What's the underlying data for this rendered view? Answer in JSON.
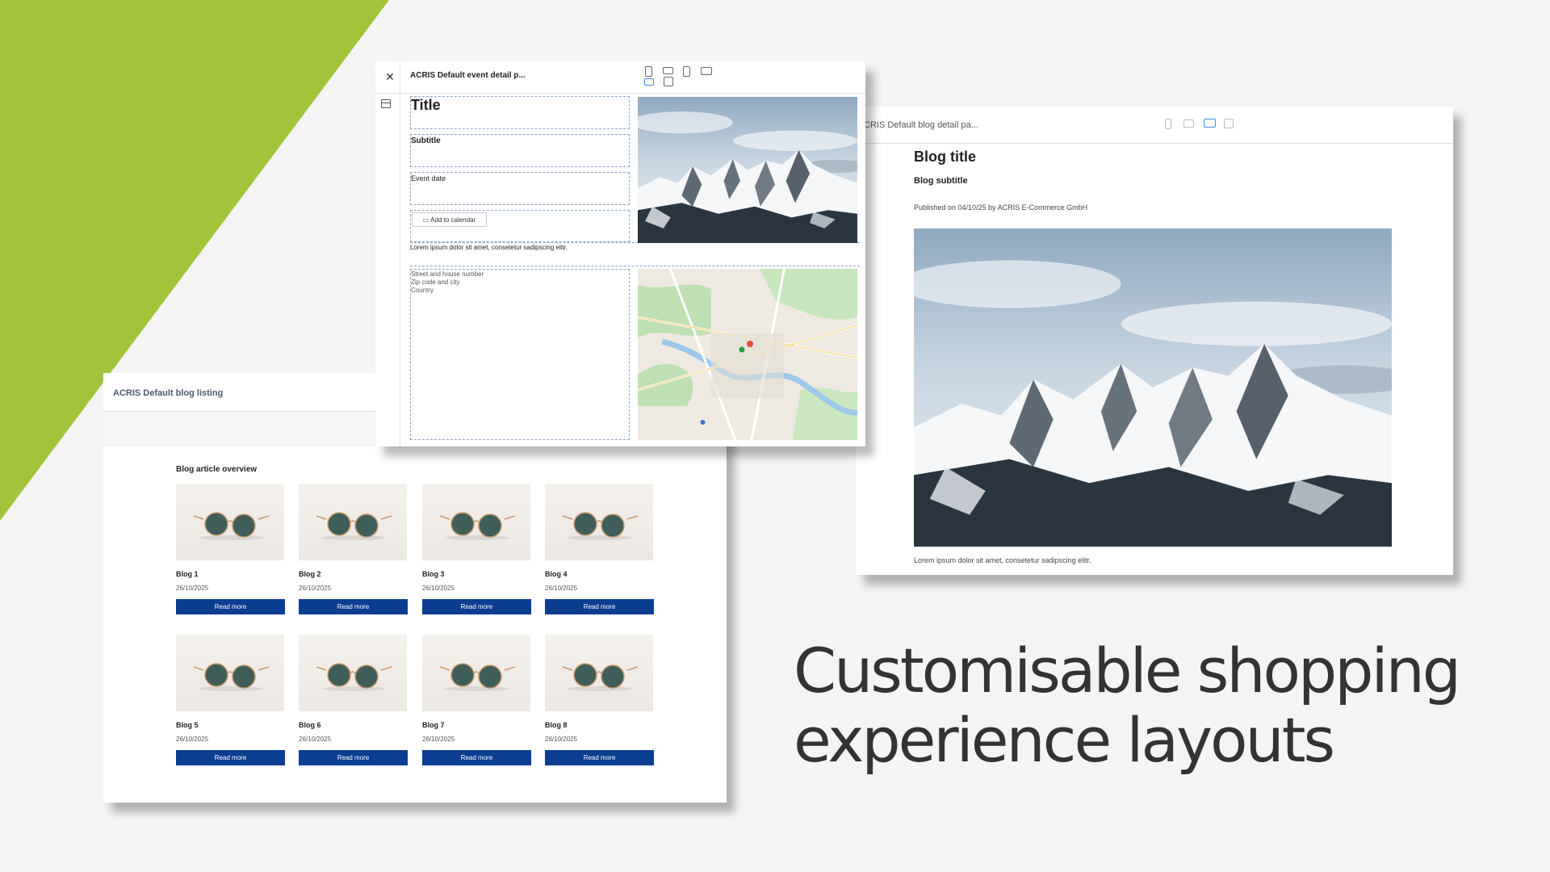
{
  "colors": {
    "accent_green": "#a3c43a",
    "button_blue": "#0b3d91",
    "selection_blue": "#3e8ee4"
  },
  "headline": {
    "line1": "Customisable shopping",
    "line2": "experience layouts"
  },
  "blog_listing": {
    "window_title": "ACRIS Default blog listing",
    "section_title": "Blog article overview",
    "cards": [
      {
        "title": "Blog 1",
        "date": "26/10/2025",
        "button": "Read more"
      },
      {
        "title": "Blog 2",
        "date": "26/10/2025",
        "button": "Read more"
      },
      {
        "title": "Blog 3",
        "date": "26/10/2025",
        "button": "Read more"
      },
      {
        "title": "Blog 4",
        "date": "26/10/2025",
        "button": "Read more"
      },
      {
        "title": "Blog 5",
        "date": "26/10/2025",
        "button": "Read more"
      },
      {
        "title": "Blog 6",
        "date": "26/10/2025",
        "button": "Read more"
      },
      {
        "title": "Blog 7",
        "date": "26/10/2025",
        "button": "Read more"
      },
      {
        "title": "Blog 8",
        "date": "26/10/2025",
        "button": "Read more"
      }
    ]
  },
  "event_detail": {
    "window_title": "ACRIS Default event detail p...",
    "title": "Title",
    "subtitle": "Subtitle",
    "event_date": "Event date",
    "calendar_button": "Add to calendar",
    "body_text": "Lorem ipsum dolor sit amet, consetetur sadipscing elitr.",
    "address": [
      "Street and house number",
      "Zip code and city",
      "Country"
    ]
  },
  "blog_detail": {
    "window_title": "CRIS Default blog detail pa...",
    "title": "Blog title",
    "subtitle": "Blog subtitle",
    "published": "Published on 04/10/25 by ACRIS E-Commerce GmbH",
    "body_text": "Lorem ipsum dolor sit amet, consetetur sadipscing elitr."
  }
}
